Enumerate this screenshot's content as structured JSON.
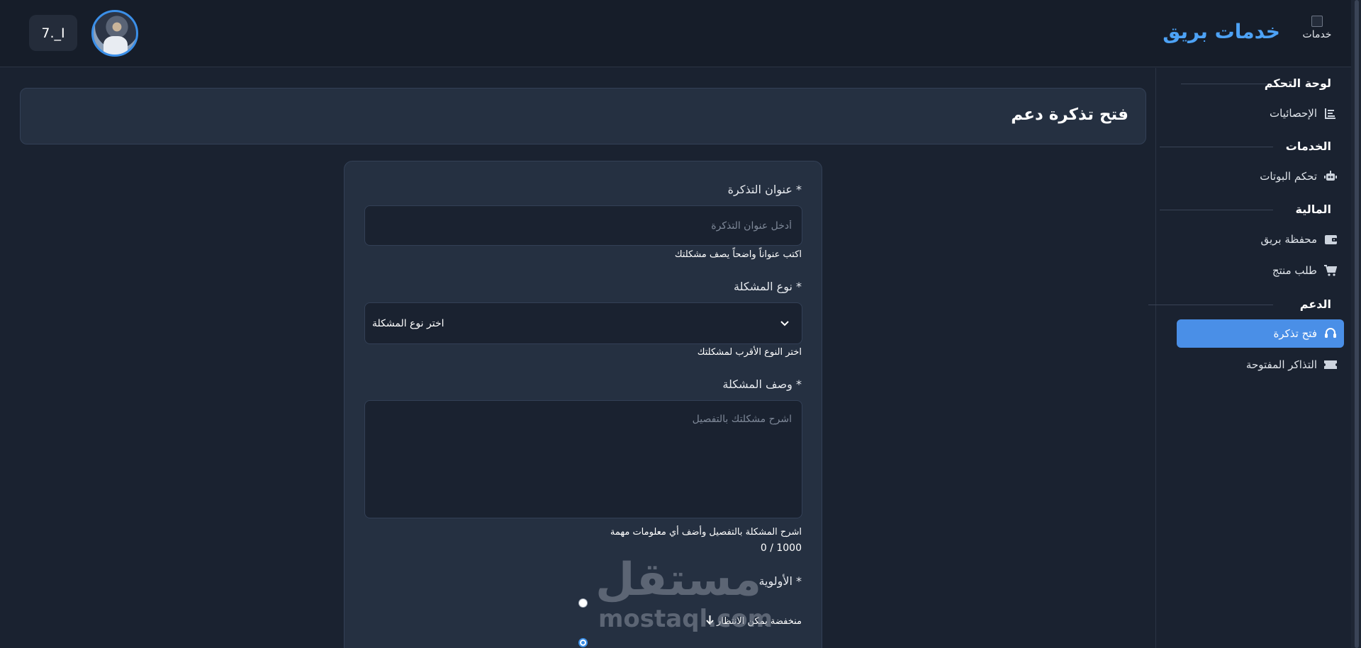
{
  "header": {
    "user_chip": "7._I",
    "brand_title": "خدمات بريق",
    "brand_logo_alt": "خدمات"
  },
  "sidebar": {
    "sections": [
      {
        "title": "لوحة التحكم",
        "items": [
          {
            "label": "الإحصائيات",
            "icon": "chart-icon"
          }
        ]
      },
      {
        "title": "الخدمات",
        "items": [
          {
            "label": "تحكم البوتات",
            "icon": "robot-icon"
          }
        ]
      },
      {
        "title": "المالية",
        "items": [
          {
            "label": "محفظة بريق",
            "icon": "wallet-icon"
          },
          {
            "label": "طلب منتج",
            "icon": "cart-icon"
          }
        ]
      },
      {
        "title": "الدعم",
        "items": [
          {
            "label": "فتح تذكرة",
            "icon": "headset-icon",
            "active": true
          },
          {
            "label": "التذاكر المفتوحة",
            "icon": "ticket-icon"
          }
        ]
      }
    ]
  },
  "page": {
    "title": "فتح تذكرة دعم"
  },
  "form": {
    "ticket_title_label": "عنوان التذكرة *",
    "ticket_title_placeholder": "أدخل عنوان التذكرة",
    "ticket_title_value": "",
    "ticket_title_hint": "اكتب عنواناً واضحاً يصف مشكلتك",
    "problem_type_label": "نوع المشكلة *",
    "problem_type_selected": "اختر نوع المشكلة",
    "problem_type_hint": "اختر النوع الأقرب لمشكلتك",
    "description_label": "وصف المشكلة *",
    "description_placeholder": "اشرح مشكلتك بالتفصيل",
    "description_hint": "اشرح المشكلة بالتفصيل وأضف أي معلومات مهمة",
    "char_counter": "0 / 1000",
    "priority_label": "الأولوية *",
    "priority_options": [
      {
        "label": "منخفضة يمكن الانتظار",
        "icon": "arrow-down-icon",
        "checked": false
      },
      {
        "label": "",
        "checked": true
      }
    ]
  },
  "watermark": {
    "arabic": "مستقل",
    "latin": "mostaql.com"
  },
  "colors": {
    "accent": "#4a8fe7",
    "brand": "#4da2f5",
    "background": "#1a2230",
    "card": "#253041"
  }
}
